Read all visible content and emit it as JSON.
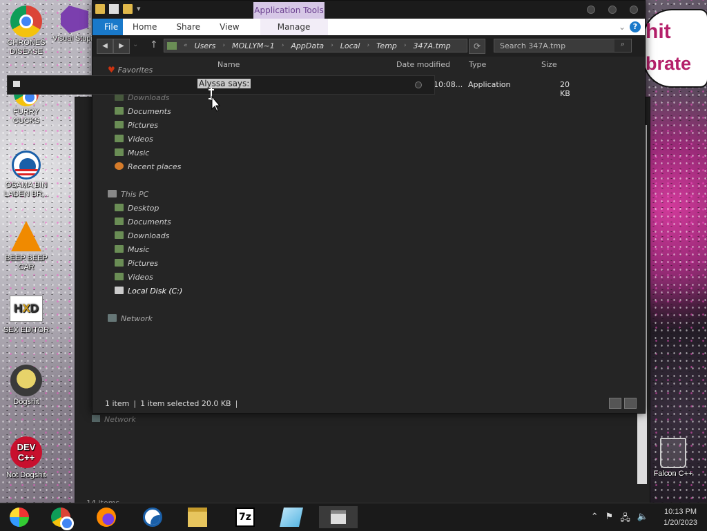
{
  "desktop": {
    "icons": [
      {
        "label": "CHRONES DISEASE"
      },
      {
        "label": "Visual Stupid"
      },
      {
        "label": "FURRY CUCKS"
      },
      {
        "label": "OSAMA BIN LADEN BR..."
      },
      {
        "label": "BEEP BEEP CAR"
      },
      {
        "label": "SEX EDITOR"
      },
      {
        "label": "Dogshit"
      },
      {
        "label": "Not Dogshit"
      },
      {
        "label": "Falcon C++"
      }
    ],
    "sign_text": [
      "hit",
      "brate"
    ],
    "dev_text": "DEV\nC++"
  },
  "dialog": {
    "title": "Alyssa says:"
  },
  "explorer": {
    "app_tools": "Application Tools",
    "ribbon": {
      "file": "File",
      "home": "Home",
      "share": "Share",
      "view": "View",
      "manage": "Manage",
      "help": "?"
    },
    "breadcrumbs": [
      "Users",
      "MOLLYM~1",
      "AppData",
      "Local",
      "Temp",
      "347A.tmp"
    ],
    "breadcrumb_prefix": "«",
    "search_placeholder": "Search 347A.tmp",
    "columns": {
      "name": "Name",
      "date": "Date modified",
      "type": "Type",
      "size": "Size"
    },
    "file": {
      "date": "10:08...",
      "type": "Application",
      "size": "20 KB"
    },
    "nav": {
      "favorites": "Favorites",
      "favorites_items": [
        "Downloads",
        "Documents",
        "Pictures",
        "Videos",
        "Music",
        "Recent places"
      ],
      "this_pc": "This PC",
      "pc_items": [
        "Desktop",
        "Documents",
        "Downloads",
        "Music",
        "Pictures",
        "Videos"
      ],
      "local_disk": "Local Disk (C:)",
      "network": "Network"
    },
    "status": {
      "count": "1 item",
      "selected": "1 item selected  20.0 KB"
    }
  },
  "back_window": {
    "network": "Network",
    "items": "14 items"
  },
  "taskbar": {
    "apps": [
      "windows-media-center-icon",
      "chrome-icon",
      "firefox-icon",
      "obama-icon",
      "file-explorer-icon",
      "7zip-icon",
      "notepad-icon",
      "explorer-window-icon"
    ],
    "time": "10:13 PM",
    "date": "1/20/2023"
  }
}
